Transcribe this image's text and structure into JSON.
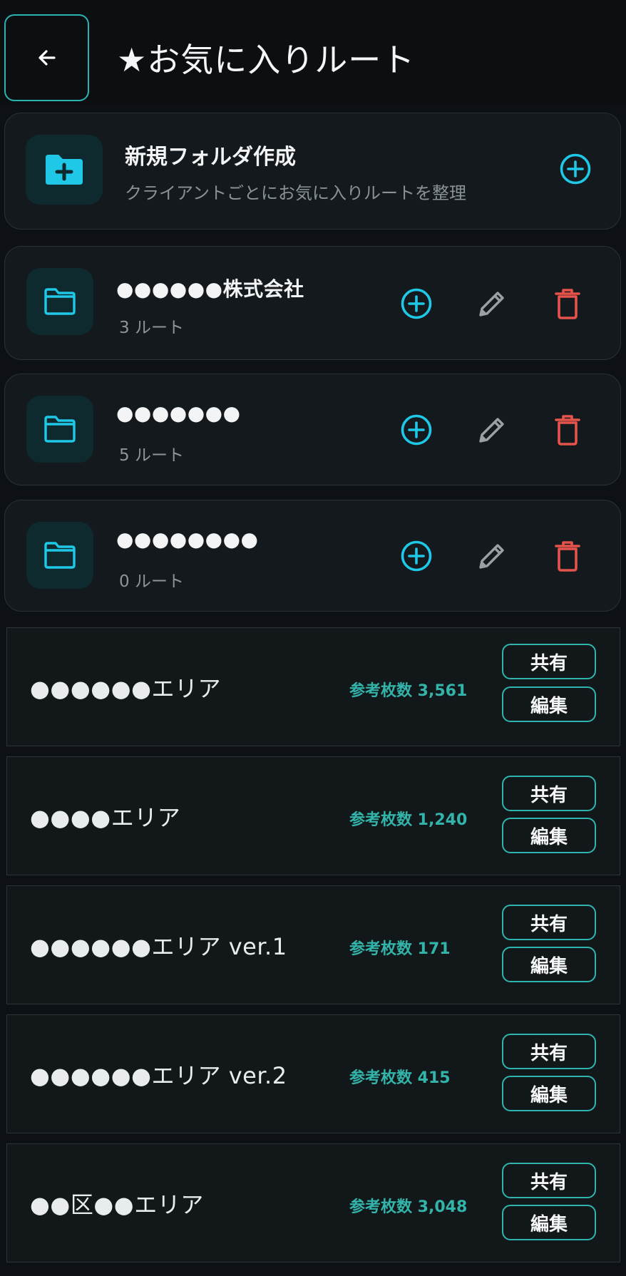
{
  "header": {
    "title": "★お気に入りルート"
  },
  "new_folder": {
    "title": "新規フォルダ作成",
    "subtitle": "クライアントごとにお気に入りルートを整理"
  },
  "folders": [
    {
      "name": "●●●●●●株式会社",
      "count": "3 ルート"
    },
    {
      "name": "●●●●●●●",
      "count": "5 ルート"
    },
    {
      "name": "●●●●●●●●",
      "count": "0 ルート"
    }
  ],
  "routes": [
    {
      "name": "●●●●●●エリア",
      "ref": "参考枚数 3,561"
    },
    {
      "name": "●●●●エリア",
      "ref": "参考枚数 1,240"
    },
    {
      "name": "●●●●●●エリア ver.1",
      "ref": "参考枚数 171"
    },
    {
      "name": "●●●●●●エリア ver.2",
      "ref": "参考枚数 415"
    },
    {
      "name": "●●区●●エリア",
      "ref": "参考枚数 3,048"
    }
  ],
  "labels": {
    "share": "共有",
    "edit": "編集"
  },
  "colors": {
    "accent_cyan": "#1ec8e6",
    "accent_teal": "#2fb5b0",
    "delete_red": "#e5534b",
    "edit_gray": "#9aa0a4"
  },
  "icons": {
    "back": "arrow-left-icon",
    "new_folder": "folder-plus-icon",
    "folder": "folder-icon",
    "add": "plus-circle-icon",
    "edit": "pencil-icon",
    "delete": "trash-icon"
  }
}
